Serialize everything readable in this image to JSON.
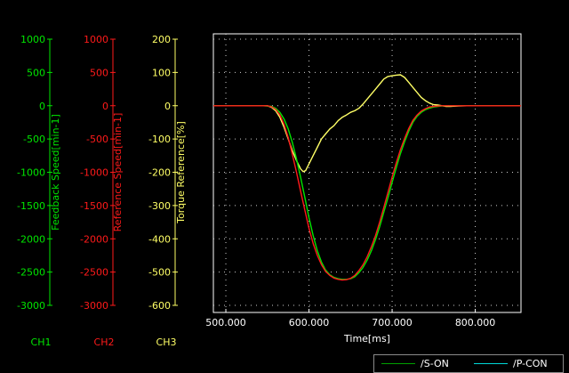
{
  "chart_data": {
    "type": "line",
    "xlabel": "Time[ms]",
    "xlim": [
      485,
      855
    ],
    "xticks": [
      {
        "v": 500,
        "label": "500.000"
      },
      {
        "v": 600,
        "label": "600.000"
      },
      {
        "v": 700,
        "label": "700.000"
      },
      {
        "v": 800,
        "label": "800.000"
      }
    ],
    "axes": [
      {
        "id": "ch1",
        "label": "Feedback Speed[min-1]",
        "channel": "CH1",
        "color": "#00e600",
        "ylim": [
          -3000,
          1000
        ],
        "ticks": [
          {
            "v": 1000,
            "label": "1000"
          },
          {
            "v": 500,
            "label": "500"
          },
          {
            "v": 0,
            "label": "0"
          },
          {
            "v": -500,
            "label": "-500"
          },
          {
            "v": -1000,
            "label": "-1000"
          },
          {
            "v": -1500,
            "label": "-1500"
          },
          {
            "v": -2000,
            "label": "-2000"
          },
          {
            "v": -2500,
            "label": "-2500"
          },
          {
            "v": -3000,
            "label": "-3000"
          }
        ]
      },
      {
        "id": "ch2",
        "label": "Reference Speed[min-1]",
        "channel": "CH2",
        "color": "#ff1a1a",
        "ylim": [
          -3000,
          1000
        ],
        "ticks": [
          {
            "v": 1000,
            "label": "1000"
          },
          {
            "v": 500,
            "label": "500"
          },
          {
            "v": 0,
            "label": "0"
          },
          {
            "v": -500,
            "label": "-500"
          },
          {
            "v": -1000,
            "label": "-1000"
          },
          {
            "v": -1500,
            "label": "-1500"
          },
          {
            "v": -2000,
            "label": "-2000"
          },
          {
            "v": -2500,
            "label": "-2500"
          },
          {
            "v": -3000,
            "label": "-3000"
          }
        ]
      },
      {
        "id": "ch3",
        "label": "Torque Reference[%]",
        "channel": "CH3",
        "color": "#ffff66",
        "ylim": [
          -600,
          200
        ],
        "ticks": [
          {
            "v": 200,
            "label": "200"
          },
          {
            "v": 100,
            "label": "100"
          },
          {
            "v": 0,
            "label": "0"
          },
          {
            "v": -100,
            "label": "-100"
          },
          {
            "v": -200,
            "label": "-200"
          },
          {
            "v": -300,
            "label": "-300"
          },
          {
            "v": -400,
            "label": "-400"
          },
          {
            "v": -500,
            "label": "-500"
          },
          {
            "v": -600,
            "label": "-600"
          }
        ]
      }
    ],
    "grid": true,
    "series": [
      {
        "axis": "ch3",
        "color": "#ffff66",
        "x": [
          485,
          550,
          555,
          560,
          565,
          570,
          575,
          580,
          585,
          590,
          593,
          596,
          600,
          605,
          610,
          615,
          620,
          625,
          630,
          635,
          640,
          645,
          650,
          655,
          660,
          665,
          670,
          675,
          680,
          685,
          690,
          695,
          700,
          705,
          710,
          715,
          720,
          725,
          730,
          735,
          740,
          745,
          750,
          755,
          760,
          765,
          770,
          780,
          790,
          800,
          855
        ],
        "y": [
          0,
          0,
          -5,
          -15,
          -35,
          -65,
          -100,
          -135,
          -165,
          -190,
          -198,
          -195,
          -175,
          -150,
          -125,
          -100,
          -85,
          -70,
          -60,
          -45,
          -35,
          -28,
          -20,
          -15,
          -8,
          5,
          20,
          35,
          50,
          65,
          80,
          88,
          90,
          92,
          93,
          85,
          70,
          55,
          40,
          25,
          15,
          8,
          3,
          2,
          0,
          -2,
          -2,
          -1,
          0,
          0,
          0
        ]
      },
      {
        "axis": "ch1",
        "color": "#00e600",
        "x": [
          485,
          545,
          555,
          560,
          565,
          570,
          575,
          580,
          585,
          590,
          595,
          600,
          605,
          610,
          615,
          620,
          625,
          630,
          635,
          640,
          645,
          650,
          655,
          660,
          665,
          670,
          675,
          680,
          685,
          690,
          695,
          700,
          705,
          710,
          715,
          720,
          725,
          730,
          735,
          740,
          745,
          750,
          755,
          760,
          765,
          770,
          780,
          790,
          800,
          855
        ],
        "y": [
          0,
          0,
          -10,
          -40,
          -100,
          -200,
          -350,
          -550,
          -800,
          -1080,
          -1380,
          -1680,
          -1950,
          -2180,
          -2350,
          -2470,
          -2540,
          -2580,
          -2600,
          -2610,
          -2610,
          -2600,
          -2570,
          -2510,
          -2430,
          -2320,
          -2180,
          -2010,
          -1820,
          -1600,
          -1380,
          -1150,
          -930,
          -720,
          -540,
          -380,
          -250,
          -160,
          -100,
          -60,
          -35,
          -20,
          -10,
          -5,
          0,
          0,
          0,
          0,
          0,
          0
        ]
      },
      {
        "axis": "ch2",
        "color": "#ff1a1a",
        "x": [
          485,
          550,
          555,
          560,
          565,
          570,
          575,
          580,
          585,
          590,
          595,
          600,
          605,
          610,
          615,
          620,
          625,
          630,
          635,
          640,
          645,
          650,
          655,
          660,
          665,
          670,
          675,
          680,
          685,
          690,
          695,
          700,
          705,
          710,
          715,
          720,
          725,
          730,
          735,
          740,
          745,
          750,
          755,
          760,
          765,
          770,
          780,
          790,
          800,
          855
        ],
        "y": [
          0,
          0,
          -15,
          -55,
          -140,
          -280,
          -480,
          -730,
          -1000,
          -1290,
          -1570,
          -1840,
          -2070,
          -2250,
          -2390,
          -2490,
          -2550,
          -2590,
          -2610,
          -2620,
          -2615,
          -2595,
          -2550,
          -2480,
          -2390,
          -2270,
          -2120,
          -1950,
          -1750,
          -1530,
          -1300,
          -1070,
          -860,
          -660,
          -490,
          -340,
          -220,
          -140,
          -80,
          -45,
          -20,
          -10,
          -5,
          0,
          0,
          0,
          0,
          0,
          0,
          0
        ]
      }
    ]
  },
  "legend": [
    {
      "label": "/S-ON",
      "color": "#00a000"
    },
    {
      "label": "/P-CON",
      "color": "#00d8d8"
    }
  ]
}
